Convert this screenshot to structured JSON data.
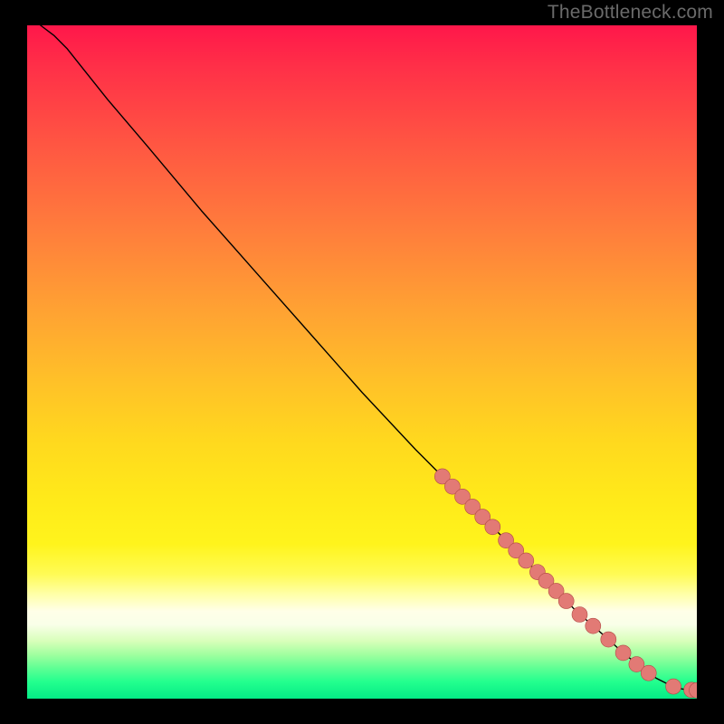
{
  "watermark": "TheBottleneck.com",
  "colors": {
    "dot_fill": "#e27a75",
    "dot_stroke": "#b24b46",
    "line": "#000000"
  },
  "chart_data": {
    "type": "line",
    "title": "",
    "xlabel": "",
    "ylabel": "",
    "xlim": [
      0,
      100
    ],
    "ylim": [
      0,
      100
    ],
    "series": [
      {
        "name": "bottleneck-curve",
        "x": [
          2,
          4,
          6,
          8,
          12,
          18,
          26,
          34,
          42,
          50,
          58,
          62,
          66,
          70,
          74,
          78,
          82,
          86,
          89,
          92,
          94,
          96,
          97,
          98,
          99,
          100
        ],
        "y": [
          100,
          98.5,
          96.5,
          94,
          89,
          82,
          72.5,
          63.5,
          54.5,
          45.5,
          37,
          33,
          29,
          25,
          21,
          17,
          13,
          9.5,
          6.8,
          4.4,
          3.0,
          2.0,
          1.6,
          1.4,
          1.3,
          1.25
        ]
      }
    ],
    "dots": [
      {
        "x": 62,
        "y": 33.0
      },
      {
        "x": 63.5,
        "y": 31.5
      },
      {
        "x": 65,
        "y": 30.0
      },
      {
        "x": 66.5,
        "y": 28.5
      },
      {
        "x": 68,
        "y": 27.0
      },
      {
        "x": 69.5,
        "y": 25.5
      },
      {
        "x": 71.5,
        "y": 23.5
      },
      {
        "x": 73,
        "y": 22.0
      },
      {
        "x": 74.5,
        "y": 20.5
      },
      {
        "x": 76.2,
        "y": 18.8
      },
      {
        "x": 77.5,
        "y": 17.5
      },
      {
        "x": 79,
        "y": 16.0
      },
      {
        "x": 80.5,
        "y": 14.5
      },
      {
        "x": 82.5,
        "y": 12.5
      },
      {
        "x": 84.5,
        "y": 10.8
      },
      {
        "x": 86.8,
        "y": 8.8
      },
      {
        "x": 89,
        "y": 6.8
      },
      {
        "x": 91,
        "y": 5.1
      },
      {
        "x": 92.8,
        "y": 3.8
      },
      {
        "x": 96.5,
        "y": 1.8
      },
      {
        "x": 99.2,
        "y": 1.3
      },
      {
        "x": 100,
        "y": 1.25
      }
    ],
    "dot_radius_pct": 1.15
  }
}
